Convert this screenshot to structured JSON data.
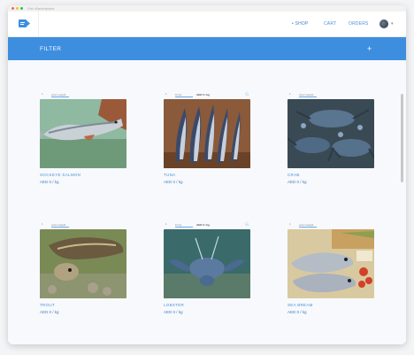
{
  "window": {
    "title": "Fish Marketplace"
  },
  "nav": {
    "shop": "• SHOP",
    "cart": "CART",
    "orders": "ORDERS"
  },
  "filter": {
    "label": "FILTER",
    "plus": "+"
  },
  "products": [
    {
      "name": "SOCKEYE SALMON",
      "price": "AED 0 / kg",
      "qty": "1",
      "unit": "enter weight",
      "aed": "",
      "star": ""
    },
    {
      "name": "TUNA",
      "price": "AED 0 / kg",
      "qty": "1",
      "unit": "10 kg",
      "aed": "AED 0 / kg",
      "star": "♘"
    },
    {
      "name": "CRAB",
      "price": "AED 0 / kg",
      "qty": "1",
      "unit": "enter weight",
      "aed": "",
      "star": ""
    },
    {
      "name": "TROUT",
      "price": "AED 0 / kg",
      "qty": "1",
      "unit": "enter weight",
      "aed": "",
      "star": ""
    },
    {
      "name": "LOBSTER",
      "price": "AED 0 / kg",
      "qty": "1",
      "unit": "10 kg",
      "aed": "AED 0 / kg",
      "star": "♘"
    },
    {
      "name": "SEA BREAM",
      "price": "AED 0 / kg",
      "qty": "1",
      "unit": "enter weight",
      "aed": "",
      "star": ""
    }
  ],
  "colors": {
    "accent": "#3e8ee0",
    "link": "#4a90d9"
  }
}
